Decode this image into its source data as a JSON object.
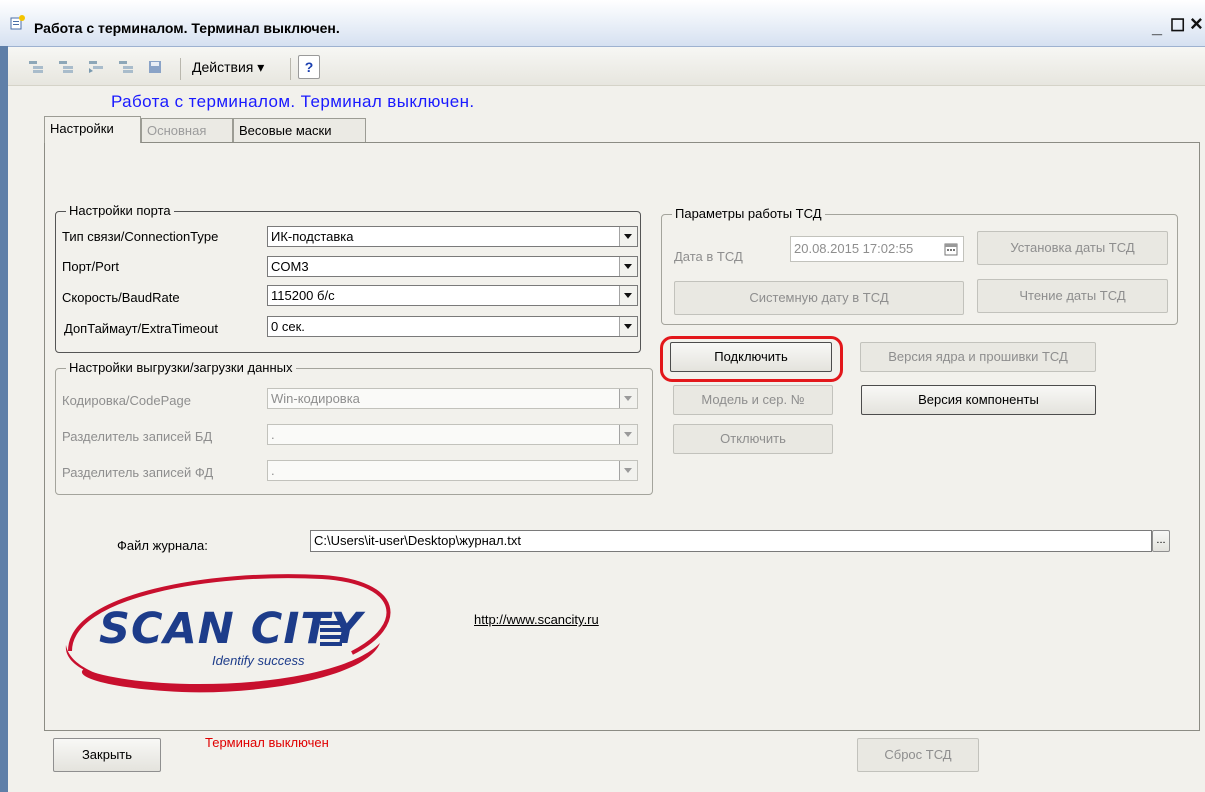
{
  "window": {
    "title": "Работа с терминалом. Терминал выключен.",
    "minimize": "_",
    "maximize": "☐",
    "close": "×"
  },
  "toolbar": {
    "actions_label": "Действия ▾",
    "help_label": "?"
  },
  "form": {
    "headline": "Работа с терминалом. Терминал выключен."
  },
  "tabs": [
    {
      "label": "Настройки",
      "state": "active"
    },
    {
      "label": "Основная",
      "state": "disabled"
    },
    {
      "label": "Весовые маски",
      "state": "normal"
    }
  ],
  "port_settings": {
    "title": "Настройки порта",
    "fields": [
      {
        "label": "Тип связи/ConnectionType",
        "value": "ИК-подставка"
      },
      {
        "label": "Порт/Port",
        "value": "COM3"
      },
      {
        "label": "Скорость/BaudRate",
        "value": "115200 б/с"
      },
      {
        "label": "ДопТаймаут/ExtraTimeout",
        "value": "0 сек."
      }
    ]
  },
  "data_settings": {
    "title": "Настройки выгрузки/загрузки данных",
    "fields": [
      {
        "label": "Кодировка/CodePage",
        "value": "Win-кодировка"
      },
      {
        "label": "Разделитель записей БД",
        "value": "."
      },
      {
        "label": "Разделитель записей ФД",
        "value": "."
      }
    ]
  },
  "tsd_params": {
    "title": "Параметры работы ТСД",
    "date_label": "Дата в ТСД",
    "date_value": "20.08.2015 17:02:55",
    "set_date_button": "Установка даты ТСД",
    "system_date_button": "Системную дату в ТСД",
    "read_date_button": "Чтение даты ТСД"
  },
  "buttons": {
    "connect": "Подключить",
    "firmware_version": "Версия ядра и прошивки ТСД",
    "model_serial": "Модель и сер. №",
    "component_version": "Версия компоненты",
    "disconnect": "Отключить",
    "close": "Закрыть",
    "reset": "Сброс ТСД",
    "browse": "..."
  },
  "log": {
    "label": "Файл журнала:",
    "value": "C:\\Users\\it-user\\Desktop\\журнал.txt"
  },
  "logo": {
    "brand": "SCAN CITY",
    "tagline": "Identify success",
    "link": "http://www.scancity.ru",
    "color_primary": "#1d3c8a",
    "color_swoosh": "#c8102e"
  },
  "status": {
    "text": "Терминал выключен",
    "color": "#e00000"
  }
}
